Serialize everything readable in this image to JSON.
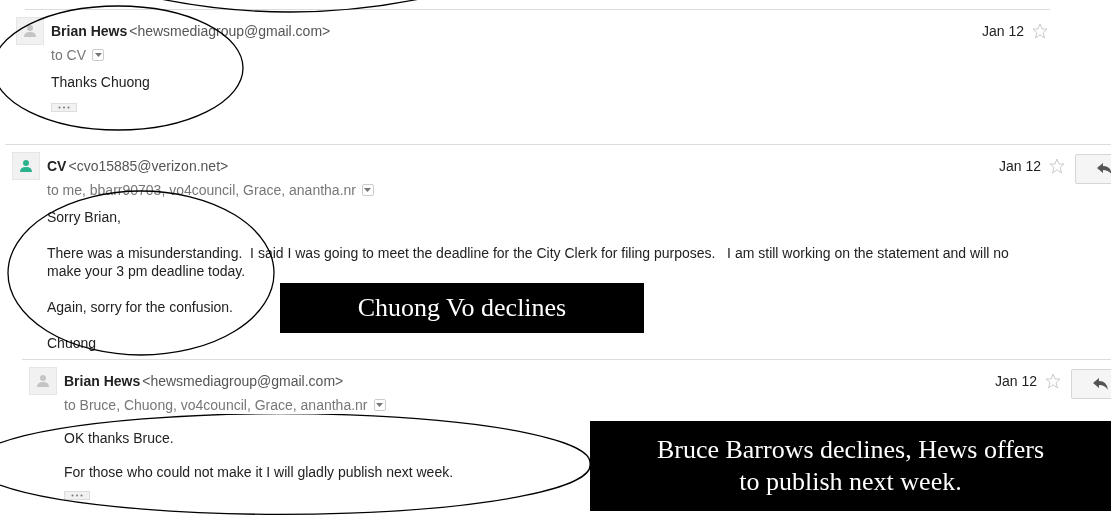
{
  "messages": [
    {
      "sender": "Brian Hews",
      "email": "<hewsmediagroup@gmail.com>",
      "recipients": "to CV",
      "date": "Jan 12",
      "starred": false,
      "color": "#c4c4c4",
      "reply_button": false,
      "show_trimmed": true,
      "body": [
        "Thanks Chuong"
      ]
    },
    {
      "sender": "CV",
      "email": "<cvo15885@verizon.net>",
      "recipients": "to me, bbarr90703, vo4council, Grace, anantha.nr",
      "date": "Jan 12",
      "starred": false,
      "color": "#2bb38e",
      "reply_button": true,
      "show_trimmed": false,
      "body": [
        "Sorry Brian,",
        "There was a misunderstanding.  I said I was going to meet the deadline for the City Clerk for filing purposes.   I am still working on the statement and will no\nmake your 3 pm deadline today.",
        "Again, sorry for the confusion.",
        "Chuong"
      ]
    },
    {
      "sender": "Brian Hews",
      "email": "<hewsmediagroup@gmail.com>",
      "recipients": "to Bruce, Chuong, vo4council, Grace, anantha.nr",
      "date": "Jan 12",
      "starred": false,
      "color": "#c4c4c4",
      "reply_button": true,
      "show_trimmed": true,
      "body": [
        "OK thanks Bruce.",
        "For those who could not make it I will gladly publish next week."
      ]
    }
  ],
  "annotations": [
    {
      "text": "Chuong Vo declines"
    },
    {
      "text": "Bruce Barrows declines, Hews offers\nto publish next week."
    }
  ]
}
